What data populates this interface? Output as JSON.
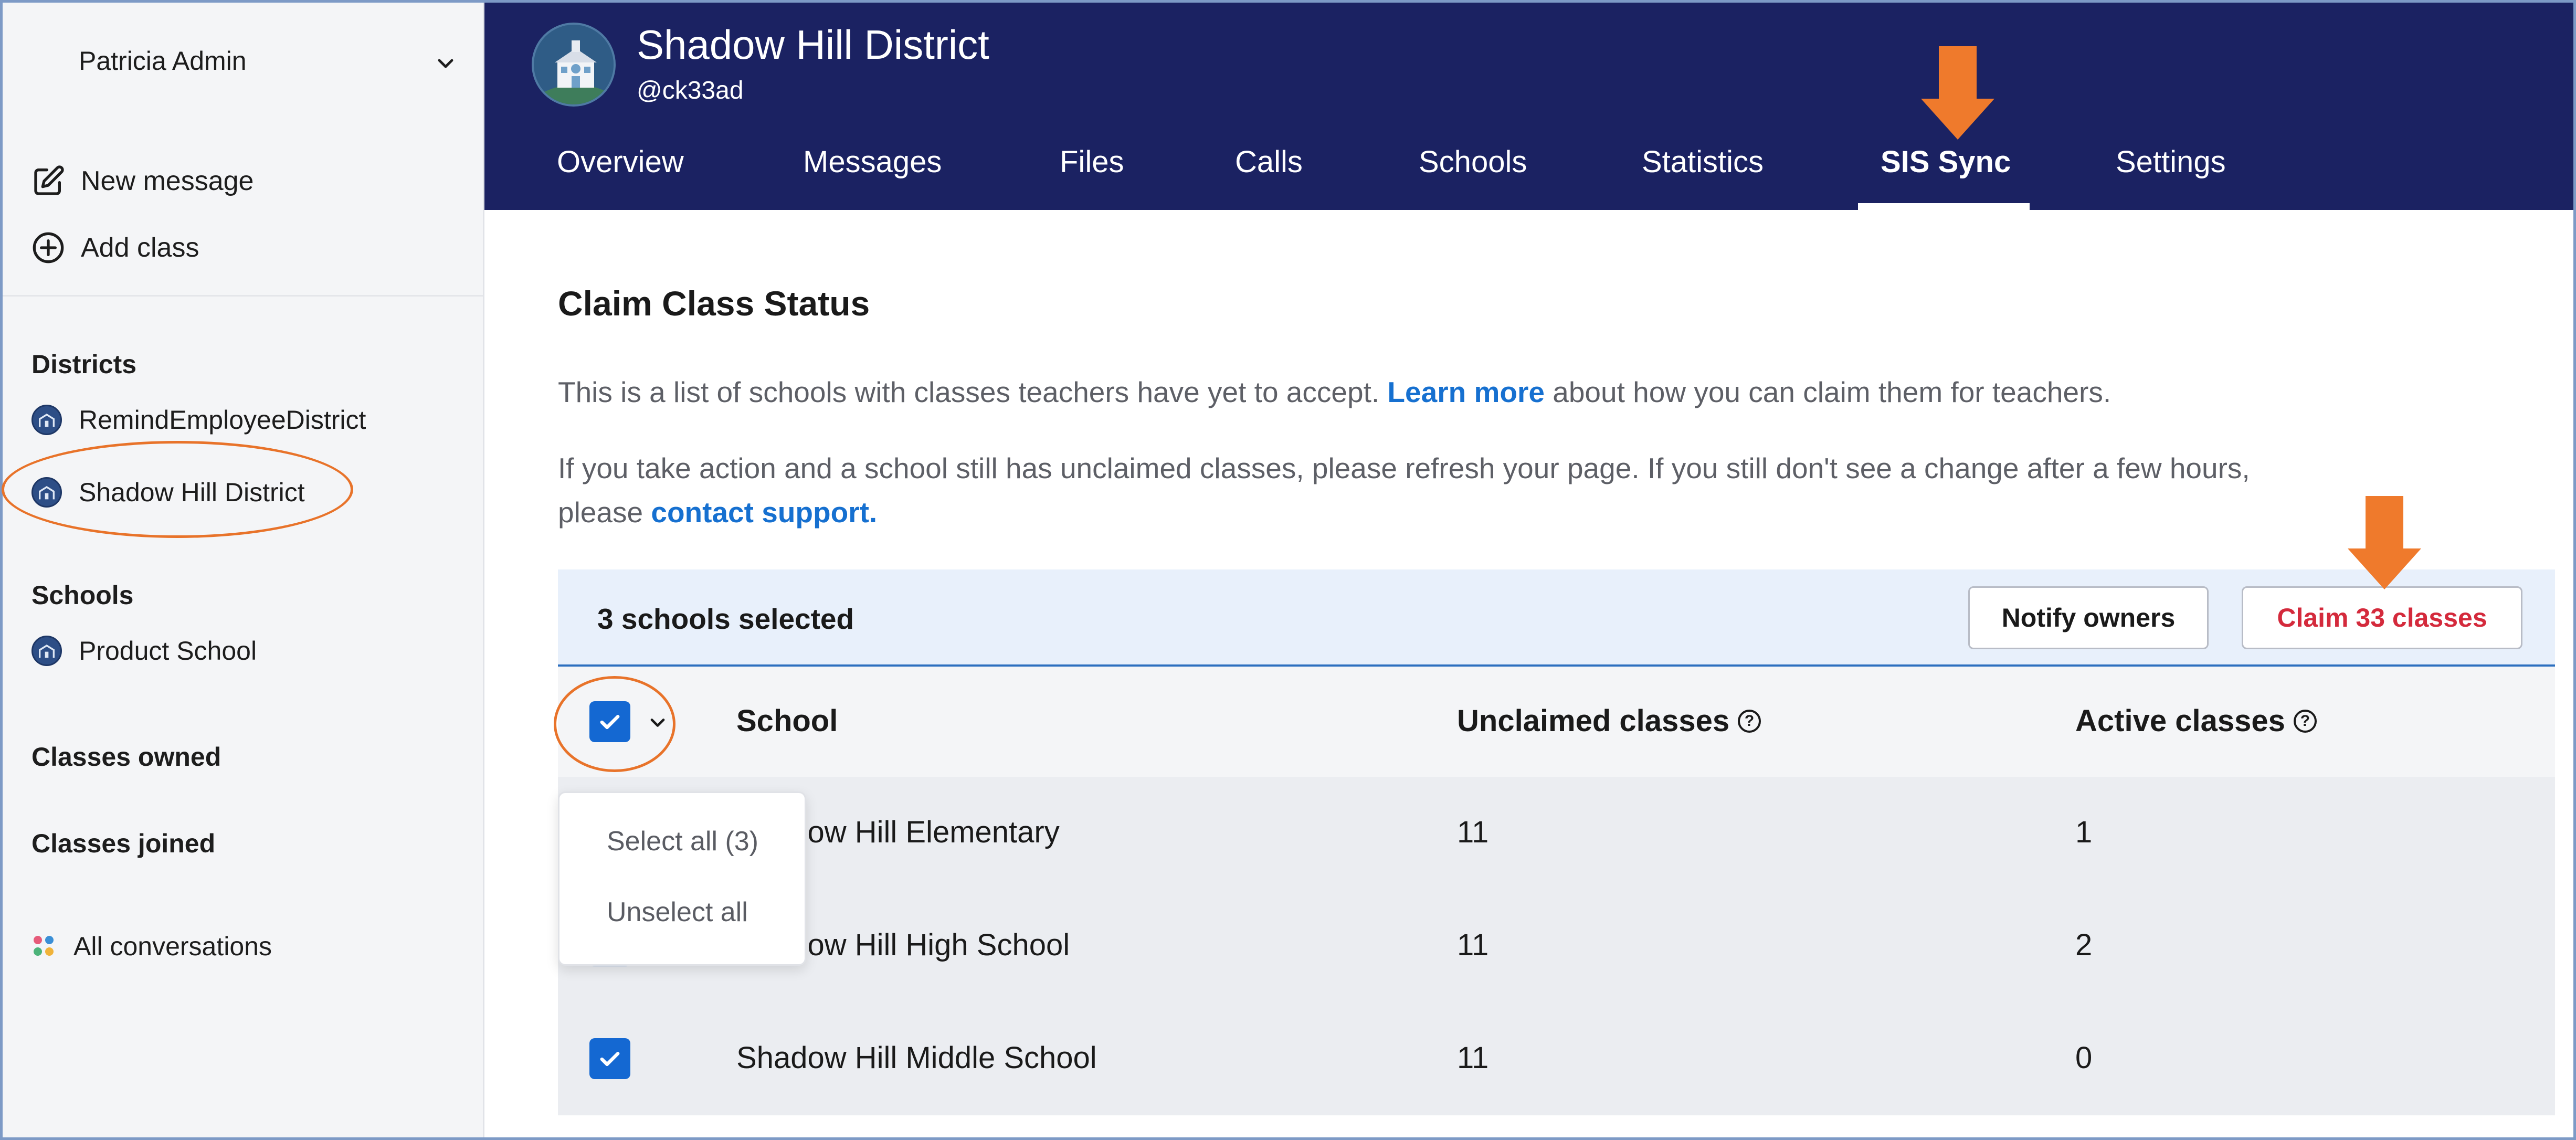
{
  "sidebar": {
    "user_name": "Patricia Admin",
    "actions": [
      {
        "label": "New message",
        "icon": "pencil-square-icon"
      },
      {
        "label": "Add class",
        "icon": "plus-circle-icon"
      }
    ],
    "districts_title": "Districts",
    "districts": [
      {
        "label": "RemindEmployeeDistrict"
      },
      {
        "label": "Shadow Hill District"
      }
    ],
    "schools_title": "Schools",
    "schools": [
      {
        "label": "Product School"
      }
    ],
    "classes_owned_title": "Classes owned",
    "classes_joined_title": "Classes joined",
    "all_conversations": "All conversations"
  },
  "header": {
    "title": "Shadow Hill District",
    "handle": "@ck33ad",
    "tabs": [
      {
        "label": "Overview"
      },
      {
        "label": "Messages"
      },
      {
        "label": "Files"
      },
      {
        "label": "Calls"
      },
      {
        "label": "Schools"
      },
      {
        "label": "Statistics"
      },
      {
        "label": "SIS Sync"
      },
      {
        "label": "Settings"
      }
    ],
    "active_tab": "SIS Sync"
  },
  "main": {
    "title": "Claim Class Status",
    "para1_prefix": "This is a list of schools with classes teachers have yet to accept.",
    "para1_link": "Learn more",
    "para1_suffix": "about how you can claim them for teachers.",
    "para2_line1": "If you take action and a school still has unclaimed classes, please refresh your page. If you still don't see a change after a few hours,",
    "para2_prefix": "please",
    "para2_link": "contact support.",
    "selection": {
      "count_label": "3 schools selected",
      "notify_label": "Notify owners",
      "claim_label": "Claim 33 classes"
    },
    "table": {
      "headers": {
        "school": "School",
        "unclaimed": "Unclaimed classes",
        "active": "Active classes"
      },
      "rows": [
        {
          "school": "Shadow Hill Elementary",
          "unclaimed": "11",
          "active": "1"
        },
        {
          "school": "Shadow Hill High School",
          "unclaimed": "11",
          "active": "2"
        },
        {
          "school": "Shadow Hill Middle School",
          "unclaimed": "11",
          "active": "0"
        }
      ]
    },
    "dropdown": {
      "select_all": "Select all (3)",
      "unselect_all": "Unselect all"
    }
  },
  "colors": {
    "header_bg": "#1b2262",
    "accent_blue": "#1468d2",
    "link_blue": "#1670d0",
    "claim_red": "#d42a3c",
    "annotation_orange": "#e8732a"
  }
}
